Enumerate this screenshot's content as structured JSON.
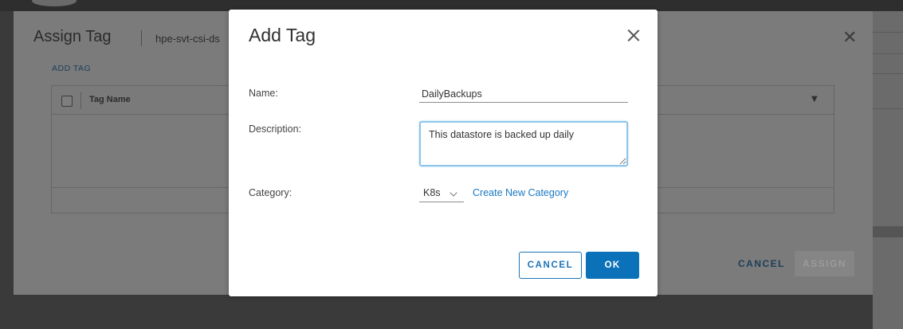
{
  "assign_dialog": {
    "title": "Assign Tag",
    "subtitle": "hpe-svt-csi-ds",
    "add_tag_link": "ADD TAG",
    "grid": {
      "column_header": "Tag Name"
    },
    "cancel_label": "CANCEL",
    "assign_label": "ASSIGN"
  },
  "add_tag_modal": {
    "title": "Add Tag",
    "name_label": "Name:",
    "name_value": "DailyBackups",
    "description_label": "Description:",
    "description_value": "This datastore is backed up daily",
    "category_label": "Category:",
    "category_value": "K8s",
    "create_category_link": "Create New Category",
    "cancel_label": "CANCEL",
    "ok_label": "OK"
  },
  "colors": {
    "primary": "#0b72b9",
    "link": "#1a78c2",
    "focus_border": "#8fc6e8"
  },
  "icons": [
    "close-icon",
    "filter-icon",
    "chevron-down-icon"
  ]
}
